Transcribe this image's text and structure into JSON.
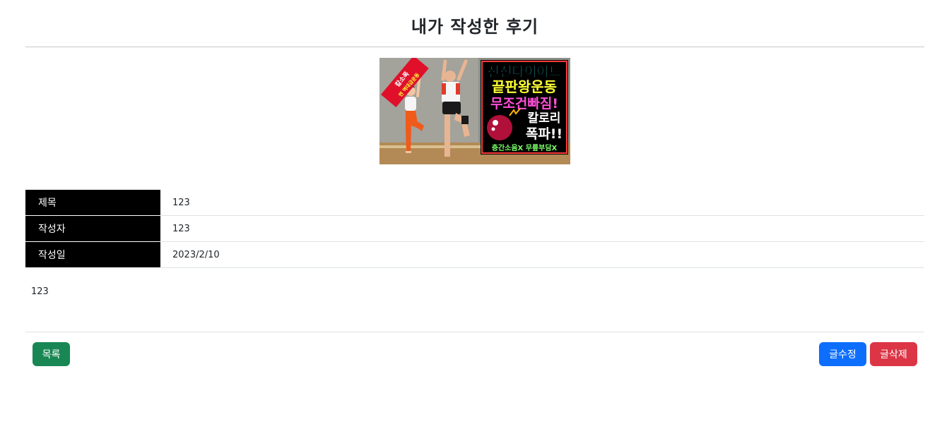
{
  "page": {
    "title": "내가 작성한 후기"
  },
  "thumbnail": {
    "badge_line1": "칼소폭",
    "badge_line2": "찐 역대급운동",
    "headline": [
      "전신다이어트",
      "끝판왕운동",
      "무조건빠짐!"
    ],
    "calorie_line1": "칼로리",
    "calorie_line2": "폭파!!",
    "footer": "층간소음X 무릎부담X",
    "colors": {
      "cyan": "#32e6f0",
      "yellow": "#ffff33",
      "pink": "#ff4fd8",
      "white": "#ffffff",
      "green": "#7dff6a",
      "floor": "#b38a55",
      "wall": "#8f8f8a"
    }
  },
  "details": {
    "rows": [
      {
        "label": "제목",
        "value": "123"
      },
      {
        "label": "작성자",
        "value": "123"
      },
      {
        "label": "작성일",
        "value": "2023/2/10"
      }
    ]
  },
  "content": {
    "body": "123"
  },
  "actions": {
    "list_label": "목록",
    "edit_label": "글수정",
    "delete_label": "글삭제",
    "colors": {
      "list": "#198754",
      "edit": "#0d6efd",
      "delete": "#dc3545"
    }
  }
}
